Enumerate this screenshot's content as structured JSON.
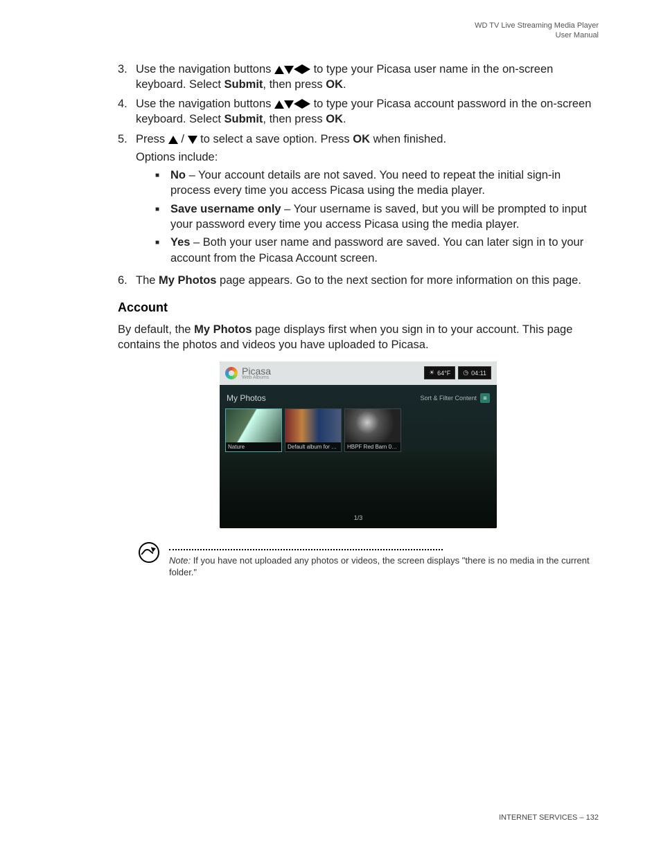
{
  "header": {
    "line1": "WD TV Live Streaming Media Player",
    "line2": "User Manual"
  },
  "steps": {
    "s3": {
      "num": "3.",
      "pre": "Use the navigation buttons ",
      "post1": "to type your Picasa user name in the on-screen keyboard. Select ",
      "submit": "Submit",
      "mid": ", then press ",
      "ok": "OK",
      "end": "."
    },
    "s4": {
      "num": "4.",
      "pre": "Use the navigation buttons ",
      "post1": "to type your Picasa account password in the on-screen keyboard. Select ",
      "submit": "Submit",
      "mid": ", then press ",
      "ok": "OK",
      "end": "."
    },
    "s5": {
      "num": "5.",
      "pre": "Press ",
      "slash": " / ",
      "post1": " to select a save option. Press ",
      "ok": "OK",
      "post2": " when finished.",
      "options_lead": "Options include:",
      "opts": [
        {
          "label": "No",
          "text": " – Your account details are not saved. You need to repeat the initial sign-in process every time you access Picasa using the media player."
        },
        {
          "label": "Save username only",
          "text": " – Your username is saved, but you will be prompted to input your password every time you access Picasa using the media player."
        },
        {
          "label": "Yes",
          "text": " – Both your user name and password are saved. You can later sign in to your account from the Picasa Account screen."
        }
      ]
    },
    "s6": {
      "num": "6.",
      "pre": "The ",
      "bold": "My Photos",
      "post": " page appears. Go to the next section for more information on this page."
    }
  },
  "section": {
    "heading": "Account",
    "para_pre": "By default, the ",
    "para_bold": "My Photos",
    "para_post": " page displays first when you sign in to your account. This page contains the photos and videos you have uploaded to Picasa."
  },
  "screenshot": {
    "app_name": "Picasa",
    "app_sub": "Web Albums",
    "temp": "64°F",
    "time": "04:11",
    "title": "My Photos",
    "sort_label": "Sort & Filter Content",
    "thumbs": [
      {
        "caption": "Nature"
      },
      {
        "caption": "Default album for n..."
      },
      {
        "caption": "HBPF Red Barn 02..."
      }
    ],
    "pager": "1/3"
  },
  "note": {
    "lead": "Note:",
    "text": " If you have not uploaded any photos or videos, the screen displays \"there is no media in the current folder.\""
  },
  "footer": {
    "section": "INTERNET SERVICES",
    "sep": " – ",
    "page": "132"
  }
}
